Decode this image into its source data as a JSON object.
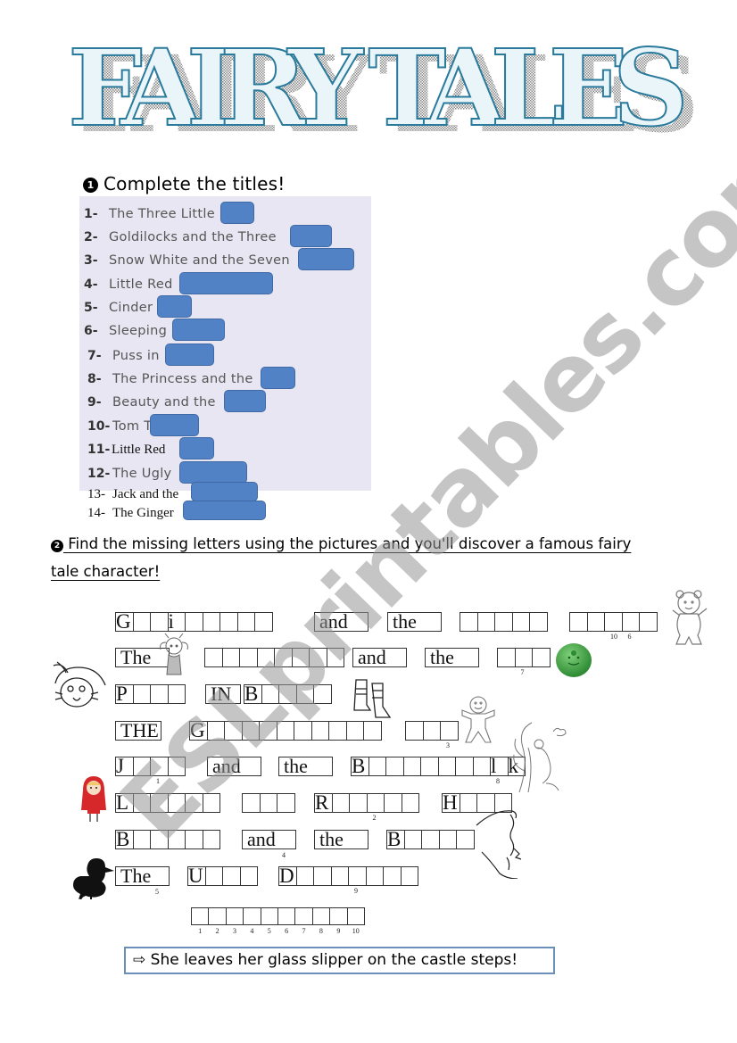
{
  "header": {
    "title": "FAIRY TALES"
  },
  "section1": {
    "bullet": "1",
    "heading": "Complete the titles!",
    "items": [
      {
        "num": "1-",
        "text": "The Three Little"
      },
      {
        "num": "2-",
        "text": "Goldilocks and the Three"
      },
      {
        "num": "3-",
        "text": "Snow White and the Seven"
      },
      {
        "num": "4-",
        "text": "Little Red"
      },
      {
        "num": "5-",
        "text": "Cinder"
      },
      {
        "num": "6-",
        "text": "Sleeping"
      },
      {
        "num": "7-",
        "text": "Puss in"
      },
      {
        "num": "8-",
        "text": "The Princess and the"
      },
      {
        "num": "9-",
        "text": "Beauty and the"
      },
      {
        "num": "10-",
        "text": "Tom T"
      },
      {
        "num": "11-",
        "text": "Little Red"
      },
      {
        "num": "12-",
        "text": "The Ugly"
      },
      {
        "num": "13-",
        "text": "Jack and the"
      },
      {
        "num": "14-",
        "text": "The Ginger"
      }
    ]
  },
  "section2": {
    "bullet": "2",
    "heading": "Find the missing letters using the pictures and you'll discover a famous fairy tale character!",
    "rows": [
      {
        "name": "goldilocks",
        "picture": "teddy-bear",
        "words": [
          {
            "given": {
              "0": "G",
              "3": "i"
            },
            "len": 9
          },
          {
            "fixed": "and"
          },
          {
            "fixed": "the"
          },
          {
            "given": {},
            "len": 5
          },
          {
            "given": {},
            "len": 5,
            "indices": {
              "2": "10",
              "3": "6"
            }
          }
        ]
      },
      {
        "name": "princess-pea",
        "picture": "pea",
        "words": [
          {
            "fixed": "The"
          },
          {
            "given": {},
            "len": 8
          },
          {
            "fixed": "and"
          },
          {
            "fixed": "the"
          },
          {
            "given": {},
            "len": 3,
            "indices": {
              "1": "7"
            }
          }
        ]
      },
      {
        "name": "puss-in-boots",
        "picture": "cat-in-hat",
        "words": [
          {
            "given": {
              "0": "P"
            },
            "len": 4
          },
          {
            "fixed": "IN"
          },
          {
            "given": {
              "0": "B"
            },
            "len": 5
          }
        ]
      },
      {
        "name": "gingerbread-man",
        "picture": "gingerbread-man",
        "words": [
          {
            "fixed": "THE"
          },
          {
            "given": {
              "0": "G"
            },
            "len": 11
          },
          {
            "given": {},
            "len": 3,
            "indices": {
              "2": "3"
            }
          }
        ]
      },
      {
        "name": "jack-beanstalk",
        "picture": "beanstalk",
        "words": [
          {
            "given": {
              "0": "J"
            },
            "len": 4,
            "indices": {
              "2": "1"
            }
          },
          {
            "fixed": "and"
          },
          {
            "fixed": "the"
          },
          {
            "given": {
              "0": "B",
              "8": "l",
              "9": "k"
            },
            "len": 10,
            "indices": {
              "8": "8"
            }
          }
        ]
      },
      {
        "name": "red-riding-hood",
        "picture": "red-riding-hood",
        "words": [
          {
            "given": {
              "0": "L"
            },
            "len": 6
          },
          {
            "given": {},
            "len": 3
          },
          {
            "given": {
              "0": "R"
            },
            "len": 6,
            "indices": {
              "3": "2"
            }
          },
          {
            "given": {
              "0": "H"
            },
            "len": 4
          }
        ]
      },
      {
        "name": "beauty-beast",
        "picture": "beast",
        "words": [
          {
            "given": {
              "0": "B"
            },
            "len": 6
          },
          {
            "fixed": "and",
            "indices": {
              "end": "4"
            }
          },
          {
            "fixed": "the"
          },
          {
            "given": {
              "0": "B"
            },
            "len": 5
          }
        ]
      },
      {
        "name": "ugly-duckling",
        "picture": "duckling",
        "words": [
          {
            "fixed": "The",
            "indices": {
              "end": "5"
            }
          },
          {
            "given": {
              "0": "U"
            },
            "len": 4
          },
          {
            "given": {
              "0": "D"
            },
            "len": 8,
            "indices": {
              "4": "9"
            }
          }
        ]
      }
    ],
    "answer": {
      "length": 10,
      "numbers": [
        "1",
        "2",
        "3",
        "4",
        "5",
        "6",
        "7",
        "8",
        "9",
        "10"
      ]
    },
    "hint": {
      "arrow": "⇨",
      "text": "She leaves her glass slipper on the castle steps!"
    }
  },
  "watermark": "ESLprintables.com",
  "colors": {
    "blank": "#5282c6",
    "panel": "#e8e6f2",
    "title_outline": "#2a7a9c",
    "hint_border": "#6a8fb9"
  }
}
